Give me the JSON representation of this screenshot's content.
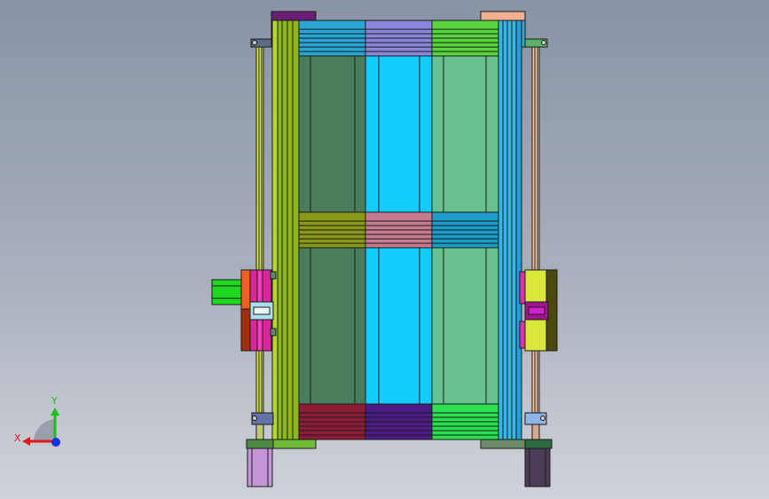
{
  "triad": {
    "x_label": "X",
    "y_label": "Y",
    "x_color": "#e01818",
    "y_color": "#18c018",
    "z_color": "#1830e0"
  },
  "colors": {
    "background_top": "#8893a6",
    "background_bottom": "#cfd2d8",
    "left_panel": "#4a7d5c",
    "center_panel": "#12ccff",
    "right_panel": "#68c08e",
    "top_band_left": "#2aa6d4",
    "top_band_mid": "#8a86dc",
    "top_band_right": "#58d43e",
    "mid_band_left": "#8a9a18",
    "mid_band_mid": "#c87a8e",
    "mid_band_right": "#1c9cc8",
    "bottom_band_left": "#8e1c36",
    "bottom_band_mid": "#4c1c86",
    "bottom_band_right": "#2ae04e",
    "left_column": "#8cb818",
    "right_column": "#36b8e8",
    "motor_left": "#c496d8",
    "motor_right": "#4c3c58",
    "actuator_left": "#20d820"
  }
}
